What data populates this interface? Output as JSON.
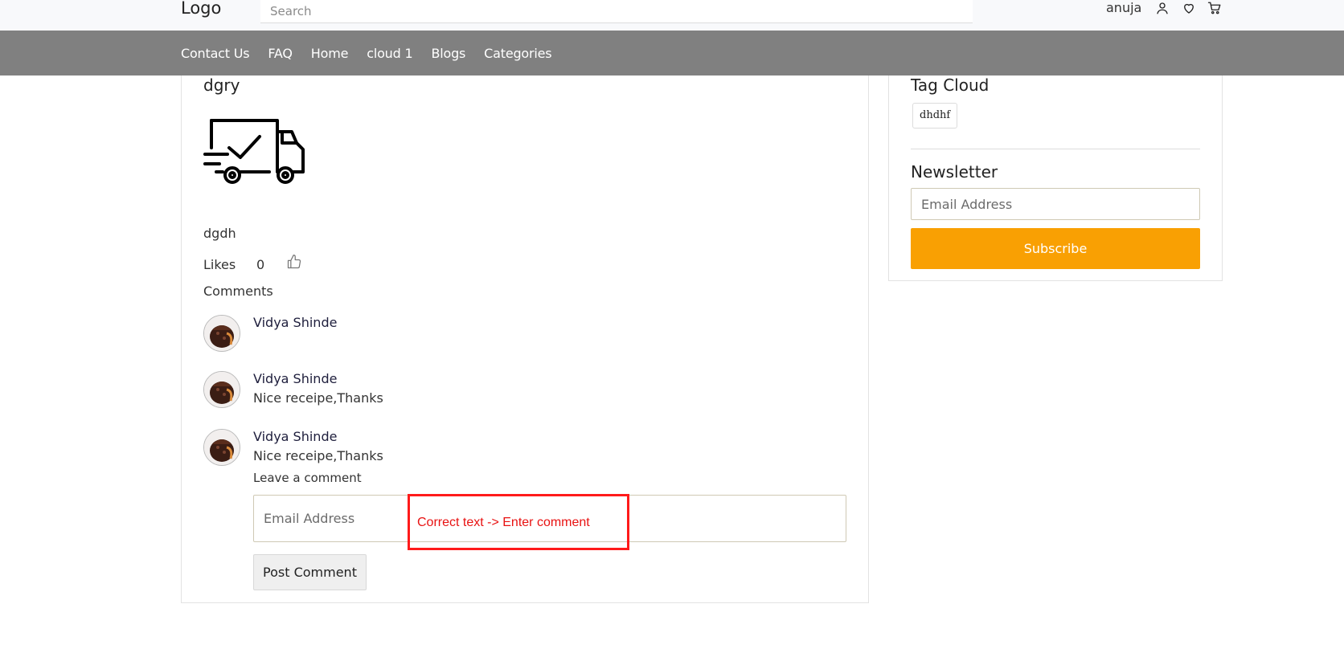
{
  "header": {
    "logo": "Logo",
    "search_placeholder": "Search",
    "user_name": "anuja",
    "icons": [
      "user-icon",
      "heart-icon",
      "cart-icon"
    ]
  },
  "nav": {
    "items": [
      "Contact Us",
      "FAQ",
      "Home",
      "cloud 1",
      "Blogs",
      "Categories"
    ]
  },
  "post": {
    "title": "dgry",
    "image_icon": "delivery-truck-check-icon",
    "body": "dgdh",
    "likes_label": "Likes",
    "likes_count": "0",
    "comments_heading": "Comments",
    "comments": [
      {
        "author": "Vidya Shinde",
        "text": ""
      },
      {
        "author": "Vidya Shinde",
        "text": "Nice receipe,Thanks"
      },
      {
        "author": "Vidya Shinde",
        "text": "Nice receipe,Thanks"
      }
    ],
    "leave_comment_label": "Leave a comment",
    "comment_placeholder": "Email Address",
    "post_button": "Post Comment"
  },
  "annotation": {
    "text": "Correct text -> Enter comment",
    "color": "#ff1a1a"
  },
  "sidebar": {
    "tag_cloud_title": "Tag Cloud",
    "tags": [
      "dhdhf"
    ],
    "newsletter_title": "Newsletter",
    "email_placeholder": "Email Address",
    "subscribe_button": "Subscribe",
    "subscribe_color": "#f9a003"
  },
  "colors": {
    "nav_bg": "#808080",
    "header_bg": "#f8f9fb"
  }
}
